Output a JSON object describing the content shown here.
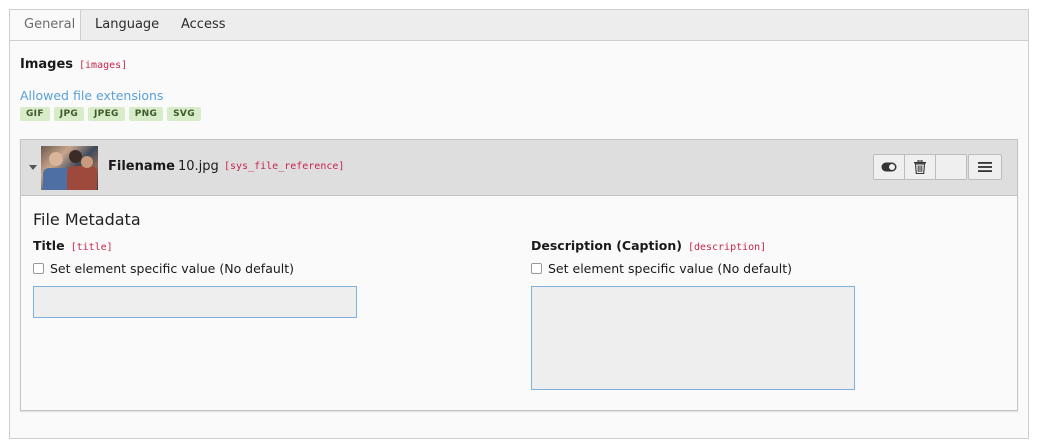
{
  "tabs": [
    {
      "label": "General",
      "active": true
    },
    {
      "label": "Language",
      "active": false
    },
    {
      "label": "Access",
      "active": false
    }
  ],
  "field": {
    "title": "Images",
    "code": "[images]",
    "allowed_label": "Allowed file extensions",
    "extensions": [
      "GIF",
      "JPG",
      "JPEG",
      "PNG",
      "SVG"
    ]
  },
  "reference": {
    "filename_label": "Filename",
    "filename_value": "10.jpg",
    "code": "[sys_file_reference]",
    "buttons": [
      "toggle-icon",
      "trash-icon",
      "blank",
      "hamburger-icon"
    ]
  },
  "metadata": {
    "heading": "File Metadata",
    "title_label": "Title",
    "title_code": "[title]",
    "title_checkbox": "Set element specific value (No default)",
    "title_value": "",
    "description_label": "Description (Caption)",
    "description_code": "[description]",
    "description_checkbox": "Set element specific value (No default)",
    "description_value": ""
  },
  "colors": {
    "code": "#c7254e",
    "link": "#5aa0d8",
    "badge_bg": "#d9ecc9",
    "input_border": "#7fb0dc"
  }
}
